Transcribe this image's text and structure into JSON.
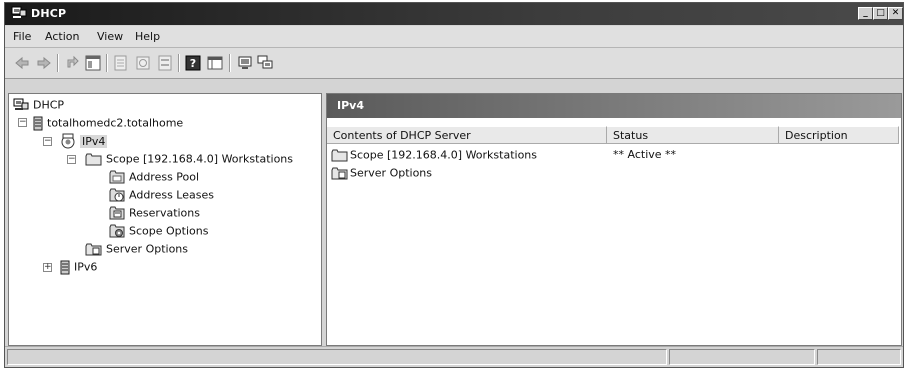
{
  "window": {
    "title": "DHCP"
  },
  "menu": {
    "items": [
      "File",
      "Action",
      "View",
      "Help"
    ]
  },
  "toolbar": {
    "buttons": [
      "back-icon",
      "forward-icon",
      "up-icon",
      "show-hide-console-tree-icon",
      "export-icon",
      "refresh-icon",
      "properties-icon",
      "help-icon",
      "mmc-icon",
      "computer-icon",
      "computers-icon"
    ]
  },
  "tree": {
    "root": "DHCP",
    "server": "totalhomedc2.totalhome",
    "ipv4": "IPv4",
    "scope": "Scope [192.168.4.0] Workstations",
    "scope_children": [
      "Address Pool",
      "Address Leases",
      "Reservations",
      "Scope Options"
    ],
    "server_options": "Server Options",
    "ipv6": "IPv6"
  },
  "panel": {
    "title": "IPv4",
    "columns": [
      "Contents of DHCP Server",
      "Status",
      "Description"
    ],
    "rows": [
      {
        "name": "Scope [192.168.4.0] Workstations",
        "status": "** Active **",
        "description": ""
      },
      {
        "name": "Server Options",
        "status": "",
        "description": ""
      }
    ]
  },
  "colors": {
    "title_bar": "#2a2a2a",
    "panel_header": "#6e6e6e",
    "chrome": "#d4d4d4"
  }
}
